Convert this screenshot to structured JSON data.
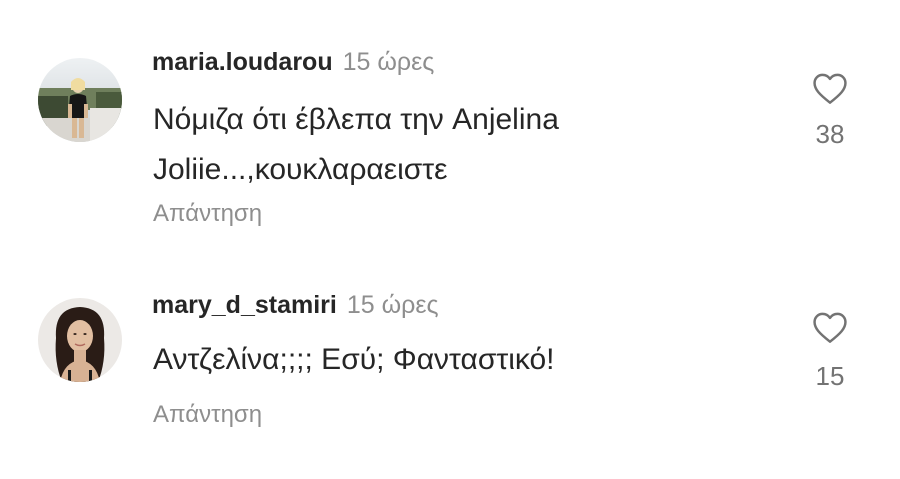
{
  "comments": [
    {
      "username": "maria.loudarou",
      "timestamp": "15 ώρες",
      "text": "Νόμιζα ότι έβλεπα την Anjelina Joliie...,κουκλαραειστε",
      "reply_label": "Απάντηση",
      "like_count": "38",
      "like_icon": "heart-outline-icon"
    },
    {
      "username": "mary_d_stamiri",
      "timestamp": "15 ώρες",
      "text": "Αντζελίνα;;;; Εσύ; Φανταστικό!",
      "reply_label": "Απάντηση",
      "like_count": "15",
      "like_icon": "heart-outline-icon"
    }
  ],
  "colors": {
    "primary_text": "#262626",
    "secondary_text": "#8e8e8e",
    "like_icon": "#737373",
    "background": "#ffffff"
  }
}
